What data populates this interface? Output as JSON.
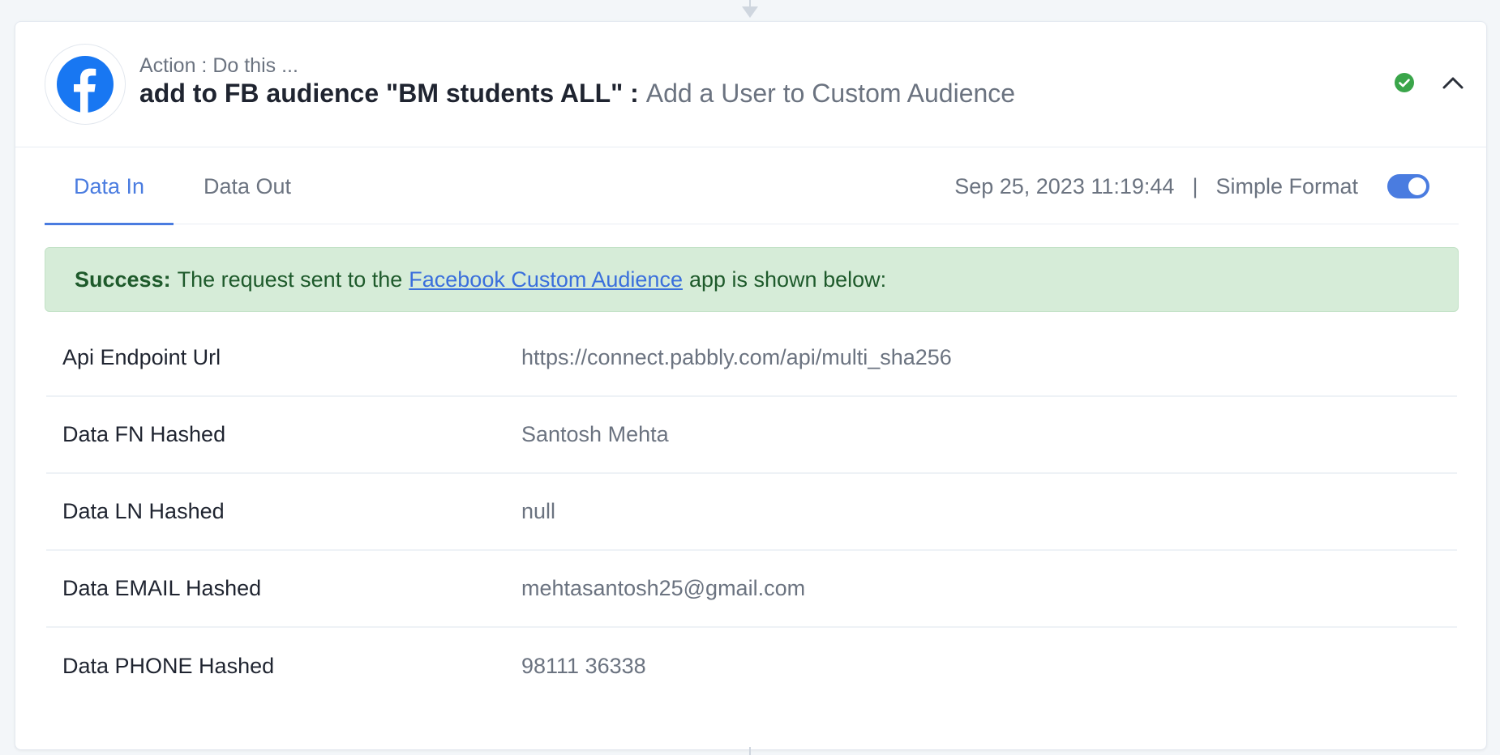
{
  "header": {
    "action_label": "Action : Do this ...",
    "title_main": "add to FB audience \"BM students ALL\" :",
    "title_sub": "Add a User to Custom Audience",
    "app_icon": "facebook-logo-icon",
    "status_icon": "check-circle-icon",
    "collapse_icon": "chevron-up-icon"
  },
  "tabs": [
    {
      "label": "Data In",
      "active": true
    },
    {
      "label": "Data Out",
      "active": false
    }
  ],
  "meta": {
    "timestamp": "Sep 25, 2023 11:19:44",
    "separator": "|",
    "format_label": "Simple Format",
    "format_toggle_on": true
  },
  "alert": {
    "prefix": "Success:",
    "text_before": "The request sent to the",
    "link": "Facebook Custom Audience",
    "text_after": "app is shown below:"
  },
  "rows": [
    {
      "key": "Api Endpoint Url",
      "value": "https://connect.pabbly.com/api/multi_sha256"
    },
    {
      "key": "Data FN Hashed",
      "value": "Santosh Mehta"
    },
    {
      "key": "Data LN Hashed",
      "value": "null"
    },
    {
      "key": "Data EMAIL Hashed",
      "value": "mehtasantosh25@gmail.com"
    },
    {
      "key": "Data PHONE Hashed",
      "value": "98111 36338"
    }
  ],
  "colors": {
    "accent": "#4a7ce0",
    "facebook": "#1877f2",
    "success_bg": "#d6ecd8",
    "success_text": "#1e5a2b",
    "status_green": "#3aa54a"
  }
}
